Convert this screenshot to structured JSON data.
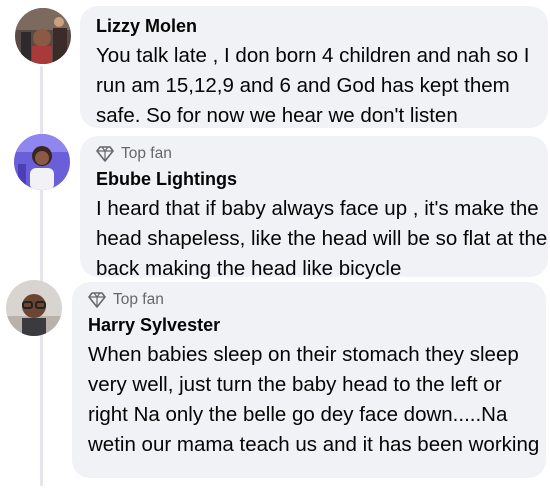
{
  "comments": [
    {
      "author": "Lizzy Molen",
      "badge": "",
      "text": "You talk late , I don born 4 children and nah so I run am 15,12,9 and 6 and God has kept them safe. So for now we hear we don't listen"
    },
    {
      "author": "Ebube Lightings",
      "badge": "Top fan",
      "text": "I heard that if baby always face up , it's make the head shapeless, like the head will be so flat at the back making the head like bicycle"
    },
    {
      "author": "Harry Sylvester",
      "badge": "Top fan",
      "text": "When babies sleep on their stomach they sleep very well, just turn the baby head to the left or right Na only the belle go dey face down.....Na wetin our mama teach us and it has been working"
    }
  ],
  "colors": {
    "bubble": "#f0f2f5",
    "thread_line": "#e4e6eb",
    "secondary_text": "#65676b",
    "primary_text": "#050505"
  },
  "icons": {
    "top_fan": "diamond-icon"
  }
}
